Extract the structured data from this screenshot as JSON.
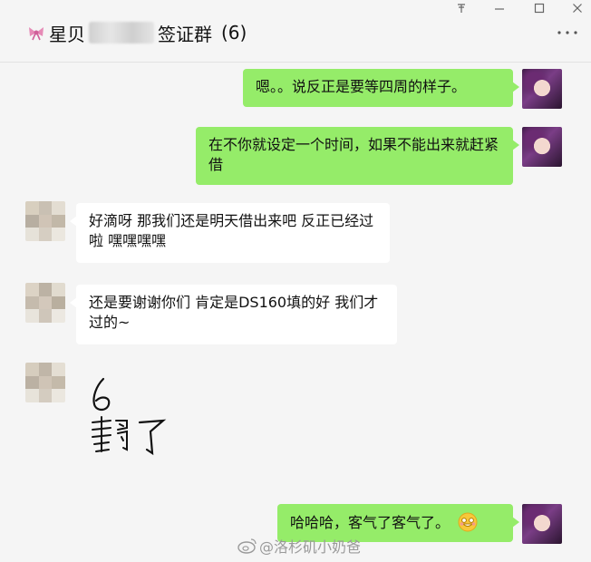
{
  "window": {
    "title_prefix": "星贝",
    "title_suffix": "签证群",
    "member_count": "(6)"
  },
  "messages": [
    {
      "side": "out",
      "text": "嗯。。说反正是要等四周的样子。"
    },
    {
      "side": "out",
      "text": "在不你就设定一个时间，如果不能出来就赶紧借"
    },
    {
      "side": "in",
      "text": "好滴呀  那我们还是明天借出来吧 反正已经过啦  嘿嘿嘿嘿"
    },
    {
      "side": "in",
      "text": "还是要谢谢你们  肯定是DS160填的好  我们才过的~"
    },
    {
      "side": "in",
      "image": "handwritten-note",
      "text": "6 翻了"
    },
    {
      "side": "out",
      "text": "哈哈哈，客气了客气了。"
    }
  ],
  "watermark": "@洛杉矶小奶爸",
  "colors": {
    "outgoing": "#95ec69",
    "incoming": "#ffffff",
    "background": "#f5f5f5"
  }
}
